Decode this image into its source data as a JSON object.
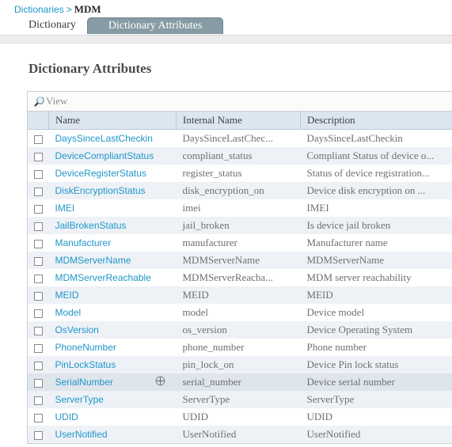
{
  "breadcrumb": {
    "root_label": "Dictionaries",
    "separator": ">",
    "current_label": "MDM"
  },
  "tabs": [
    {
      "label": "Dictionary",
      "selected": false
    },
    {
      "label": "Dictionary Attributes",
      "selected": true
    }
  ],
  "page": {
    "title": "Dictionary Attributes"
  },
  "toolbar": {
    "view_label": "View",
    "search_icon": "magnifier-icon"
  },
  "table": {
    "columns": [
      "",
      "Name",
      "Internal Name",
      "Description",
      ""
    ],
    "rows": [
      {
        "name": "DaysSinceLastCheckin",
        "internal": "DaysSinceLastChec...",
        "description": "DaysSinceLastCheckin",
        "hovered": false
      },
      {
        "name": "DeviceCompliantStatus",
        "internal": "compliant_status",
        "description": "Compliant Status of device o...",
        "hovered": false
      },
      {
        "name": "DeviceRegisterStatus",
        "internal": "register_status",
        "description": "Status of device registration...",
        "hovered": false
      },
      {
        "name": "DiskEncryptionStatus",
        "internal": "disk_encryption_on",
        "description": "Device disk encryption on ...",
        "hovered": false
      },
      {
        "name": "IMEI",
        "internal": "imei",
        "description": "IMEI",
        "hovered": false
      },
      {
        "name": "JailBrokenStatus",
        "internal": "jail_broken",
        "description": "Is device jail broken",
        "hovered": false
      },
      {
        "name": "Manufacturer",
        "internal": "manufacturer",
        "description": "Manufacturer name",
        "hovered": false
      },
      {
        "name": "MDMServerName",
        "internal": "MDMServerName",
        "description": "MDMServerName",
        "hovered": false
      },
      {
        "name": "MDMServerReachable",
        "internal": "MDMServerReacha...",
        "description": "MDM server reachability",
        "hovered": false
      },
      {
        "name": "MEID",
        "internal": "MEID",
        "description": "MEID",
        "hovered": false
      },
      {
        "name": "Model",
        "internal": "model",
        "description": "Device model",
        "hovered": false
      },
      {
        "name": "OsVersion",
        "internal": "os_version",
        "description": "Device Operating System",
        "hovered": false
      },
      {
        "name": "PhoneNumber",
        "internal": "phone_number",
        "description": "Phone number",
        "hovered": false
      },
      {
        "name": "PinLockStatus",
        "internal": "pin_lock_on",
        "description": "Device Pin lock status",
        "hovered": false
      },
      {
        "name": "SerialNumber",
        "internal": "serial_number",
        "description": "Device serial number",
        "hovered": true
      },
      {
        "name": "ServerType",
        "internal": "ServerType",
        "description": "ServerType",
        "hovered": false
      },
      {
        "name": "UDID",
        "internal": "UDID",
        "description": "UDID",
        "hovered": false
      },
      {
        "name": "UserNotified",
        "internal": "UserNotified",
        "description": "UserNotified",
        "hovered": false
      }
    ]
  },
  "colors": {
    "link": "#2196c9",
    "tab_selected_bg": "#869ba3",
    "header_bg": "#dce6f1",
    "row_alt_bg": "#eef2f6",
    "row_hover_bg": "#dfe5ec"
  }
}
